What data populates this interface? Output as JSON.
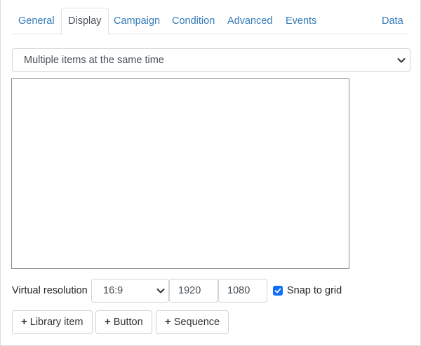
{
  "tabs": [
    {
      "label": "General",
      "active": false
    },
    {
      "label": "Display",
      "active": true
    },
    {
      "label": "Campaign",
      "active": false
    },
    {
      "label": "Condition",
      "active": false
    },
    {
      "label": "Advanced",
      "active": false
    },
    {
      "label": "Events",
      "active": false
    },
    {
      "label": "Data",
      "active": false
    }
  ],
  "display_mode": {
    "selected": "Multiple items at the same time"
  },
  "resolution": {
    "label": "Virtual resolution",
    "ratio": "16:9",
    "width": "1920",
    "height": "1080"
  },
  "snap": {
    "label": "Snap to grid",
    "checked": true
  },
  "buttons": {
    "library_item": "Library item",
    "button": "Button",
    "sequence": "Sequence",
    "plus_glyph": "+"
  },
  "colors": {
    "link": "#337ab7",
    "checkbox": "#0d6efd"
  }
}
